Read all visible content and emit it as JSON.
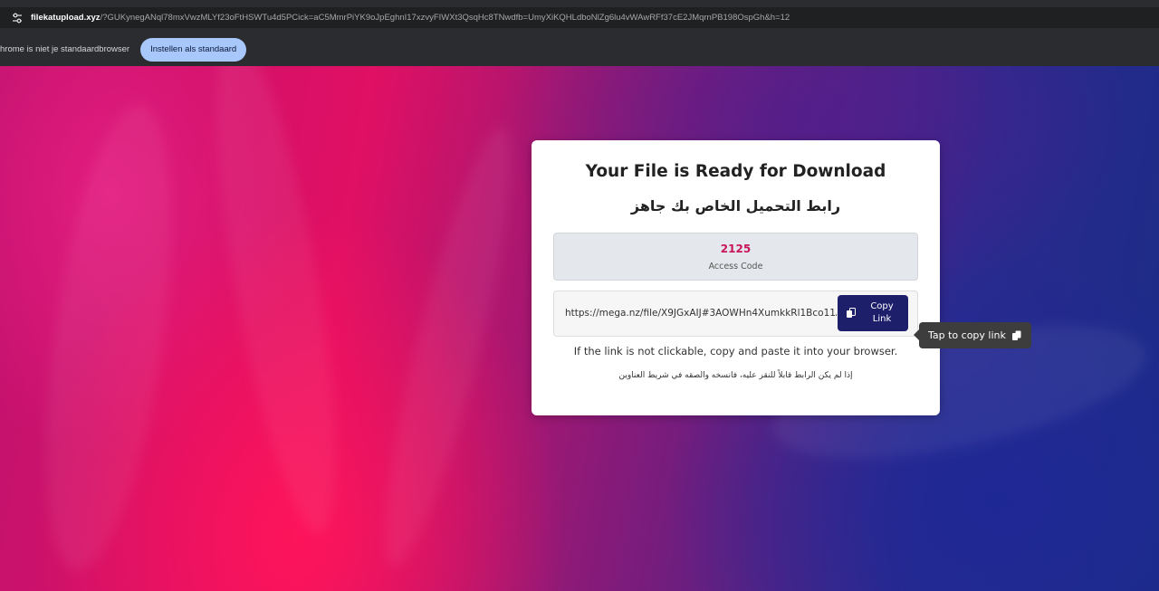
{
  "browser": {
    "url_host": "filekatupload.xyz",
    "url_rest": "/?GUKynegANql78mxVwzMLYf23oFtHSWTu4d5PCick=aC5MmrPiYK9oJpEghnI17xzvyFIWXt3QsqHc8TNwdfb=UmyXiKQHLdboNlZg6lu4vWAwRFf37cE2JMqrnPB198OspGh&h=12",
    "infobar_message": "hrome is niet je standaardbrowser",
    "infobar_button": "Instellen als standaard"
  },
  "card": {
    "title": "Your File is Ready for Download",
    "subtitle_ar": "رابط التحميل الخاص بك جاهز",
    "access_code": "2125",
    "access_label": "Access Code",
    "link_url": "https://mega.nz/file/X9JGxAIJ#3AOWHn4XumkkRl1Bco11Asc",
    "copy_button_line1": "Copy",
    "copy_button_line2": "Link",
    "hint_en": "If the link is not clickable, copy and paste it into your browser.",
    "hint_ar": "إذا لم يكن الرابط قابلاً للنقر عليه، فانسخه والصقه في شريط العناوين"
  },
  "tooltip": {
    "text": "Tap to copy link"
  },
  "colors": {
    "access_code": "#c8145a",
    "copy_button": "#1e1f6a",
    "infobar_button": "#a8c7fa"
  },
  "icons": {
    "site_info": "tune-icon",
    "copy": "copy-icon"
  }
}
